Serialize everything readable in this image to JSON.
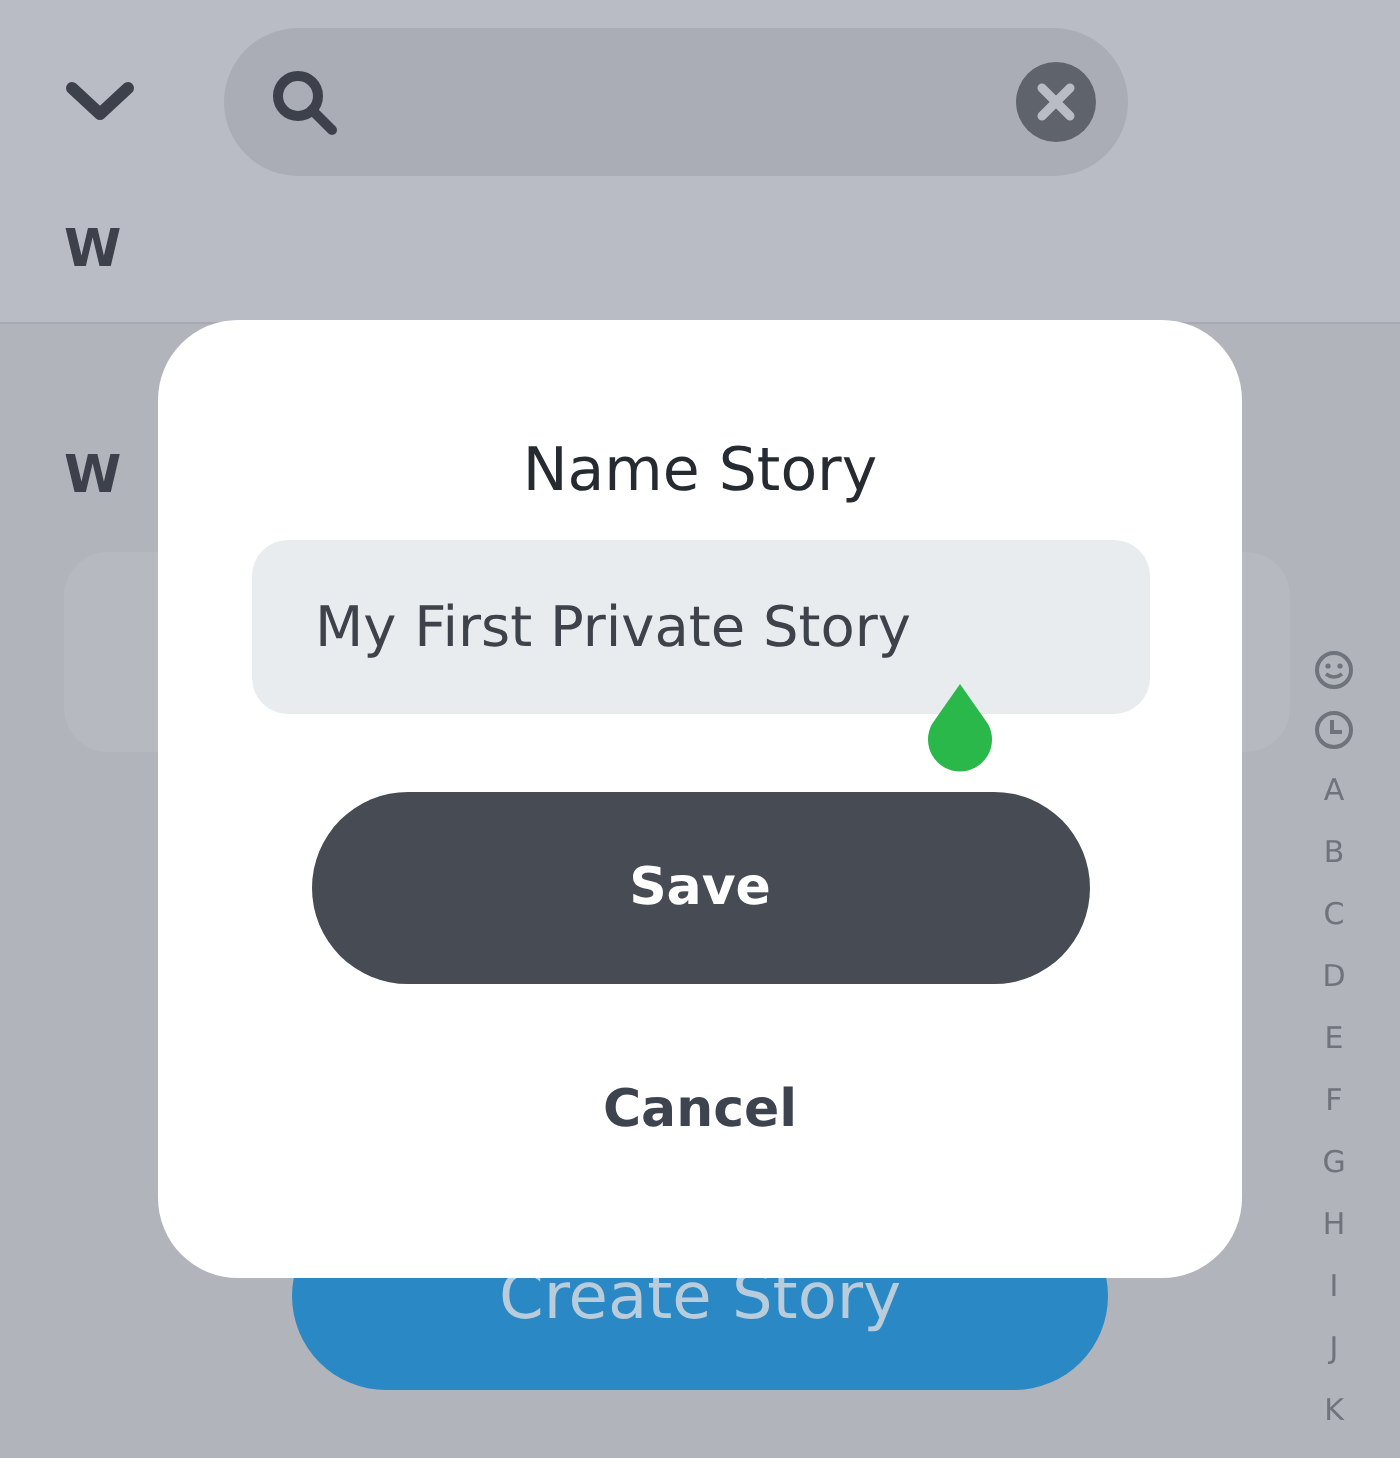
{
  "header": {
    "section_letter": "W"
  },
  "list": {
    "section_letter": "W"
  },
  "index": [
    {
      "kind": "smiley"
    },
    {
      "kind": "clock"
    },
    {
      "kind": "letter",
      "label": "A"
    },
    {
      "kind": "letter",
      "label": "B"
    },
    {
      "kind": "letter",
      "label": "C"
    },
    {
      "kind": "letter",
      "label": "D"
    },
    {
      "kind": "letter",
      "label": "E"
    },
    {
      "kind": "letter",
      "label": "F"
    },
    {
      "kind": "letter",
      "label": "G"
    },
    {
      "kind": "letter",
      "label": "H"
    },
    {
      "kind": "letter",
      "label": "I"
    },
    {
      "kind": "letter",
      "label": "J"
    },
    {
      "kind": "letter",
      "label": "K"
    }
  ],
  "create_button": "Create Story",
  "dialog": {
    "title": "Name Story",
    "field": {
      "value": "My First Private Story"
    },
    "save": "Save",
    "cancel": "Cancel"
  }
}
